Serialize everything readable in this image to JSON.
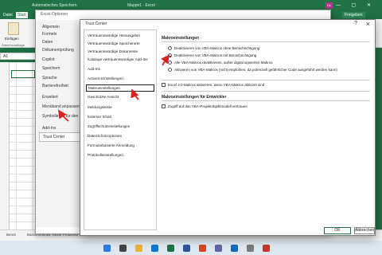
{
  "excel": {
    "title_left": "Automatisches Speichern",
    "title_file": "Mappe1 - Excel",
    "user_initials": "DL",
    "ribbon_tabs": [
      "Datei",
      "Start"
    ],
    "paste_label": "Einfügen",
    "group_label": "Zwischenablage",
    "name_box": "A1",
    "sheet_tab": "Tabelle1",
    "share_label": "Freigeben",
    "status_ready": "Bereit",
    "status_accessibility": "Barrierefreiheit: Keine Probleme",
    "accent": "#217346"
  },
  "options": {
    "title": "Excel-Optionen",
    "items": [
      "Allgemein",
      "Formeln",
      "Daten",
      "Dokumentprüfung",
      "Copilot",
      "Speichern",
      "Sprache",
      "Barrierefreiheit",
      "Erweitert",
      "Menüband anpassen",
      "Symbolleiste für den Schnellzugriff",
      "Add-Ins",
      "Trust Center"
    ],
    "active": "Trust Center"
  },
  "trust_center": {
    "title": "Trust Center",
    "help_icon": "?",
    "close_icon": "×",
    "nav": [
      "Vertrauenswürdige Herausgeber",
      "Vertrauenswürdige Speicherorte",
      "Vertrauenswürdige Dokumente",
      "Kataloge vertrauenswürdiger Add-Ins",
      "Add-Ins",
      "ActiveX-Einstellungen",
      "Makroeinstellungen",
      "Geschützte Ansicht",
      "Meldungsleiste",
      "Externer Inhalt",
      "Zugriffschutzeinstellungen",
      "Datenschutzoptionen",
      "Formularbasierte Anmeldung",
      "Protokolleinstellungen"
    ],
    "active_nav": "Makroeinstellungen",
    "macro_section_title": "Makroeinstellungen",
    "macro_options": [
      "Deaktivieren von VBA-Makros ohne Benachrichtigung",
      "Deaktivieren von VBA-Makros mit Benachrichtigung",
      "Alle VBA-Makros deaktivieren, außer digital signierten Makros",
      "Aktivieren von VBA-Makros (nicht empfohlen, da potenziell gefährlicher Code ausgeführt werden kann)"
    ],
    "selected_macro_option": 1,
    "excel4_checkbox": "Excel 4.0-Makros aktivieren, wenn VBA-Makros aktiviert sind",
    "dev_section_title": "Makroeinstellungen für Entwickler",
    "dev_checkbox": "Zugriff auf das VBA-Projektobjektmodell vertrauen",
    "ok_label": "OK",
    "cancel_label": "Abbrechen",
    "arrow_color": "#d9211e"
  }
}
